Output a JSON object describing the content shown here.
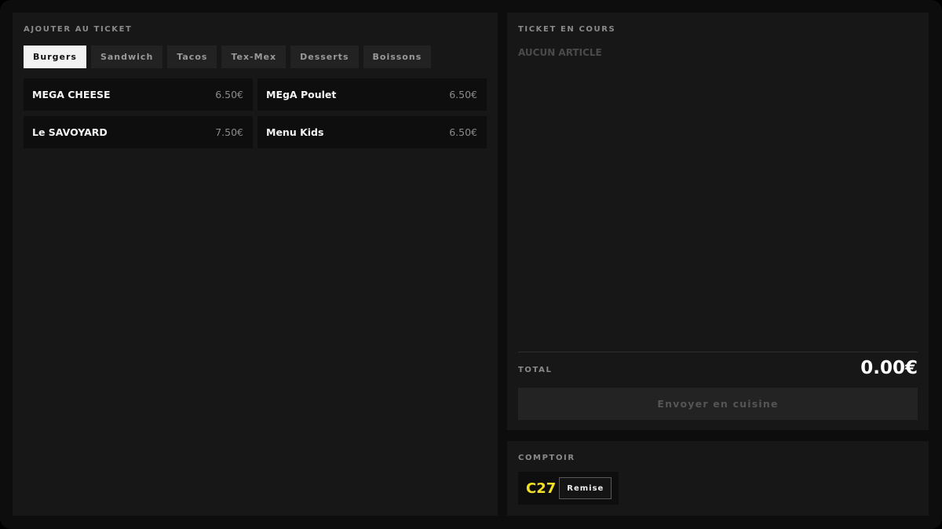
{
  "menu": {
    "title": "AJOUTER AU TICKET",
    "tabs": [
      {
        "label": "Burgers",
        "active": true
      },
      {
        "label": "Sandwich",
        "active": false
      },
      {
        "label": "Tacos",
        "active": false
      },
      {
        "label": "Tex-Mex",
        "active": false
      },
      {
        "label": "Desserts",
        "active": false
      },
      {
        "label": "Boissons",
        "active": false
      }
    ],
    "products": [
      {
        "name": "MEGA CHEESE",
        "price": "6.50€"
      },
      {
        "name": "MEgA Poulet",
        "price": "6.50€"
      },
      {
        "name": "Le SAVOYARD",
        "price": "7.50€"
      },
      {
        "name": "Menu Kids",
        "price": "6.50€"
      }
    ]
  },
  "ticket": {
    "title": "TICKET EN COURS",
    "empty_label": "AUCUN ARTICLE",
    "total_label": "TOTAL",
    "total_value": "0.00€",
    "send_label": "Envoyer en cuisine"
  },
  "counter": {
    "title": "COMPTOIR",
    "code": "C27",
    "remise_label": "Remise"
  },
  "colors": {
    "accent_yellow": "#f2e022",
    "active_tab_bg": "#f2f2f2",
    "panel_bg": "#171717"
  }
}
